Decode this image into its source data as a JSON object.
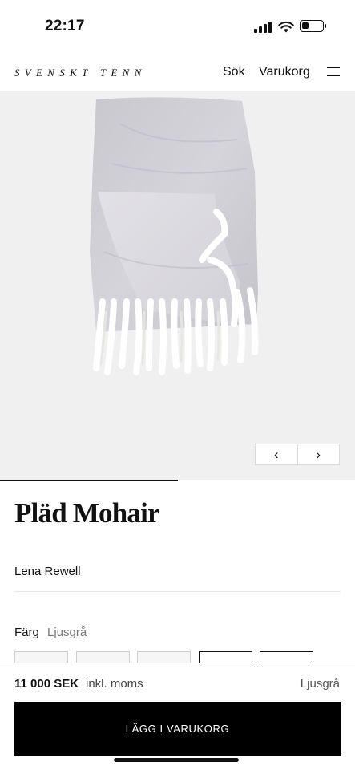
{
  "status_bar": {
    "time": "22:17",
    "battery_level": 0.35
  },
  "header": {
    "logo": "Svenskt Tenn",
    "search_label": "Sök",
    "cart_label": "Varukorg",
    "menu_icon": "hamburger-menu-icon"
  },
  "gallery": {
    "prev_icon": "‹",
    "next_icon": "›",
    "background": "#f0f0f0",
    "progress": 0.5
  },
  "product": {
    "title": "Pläd Mohair",
    "designer": "Lena Rewell",
    "color_label": "Färg",
    "color_value": "Ljusgrå",
    "swatch_count": 5
  },
  "purchase": {
    "price": "11 000 SEK",
    "vat_note": "inkl. moms",
    "selected_color": "Ljusgrå",
    "add_to_cart_label": "LÄGG I VARUKORG",
    "button_color": "#000000"
  }
}
